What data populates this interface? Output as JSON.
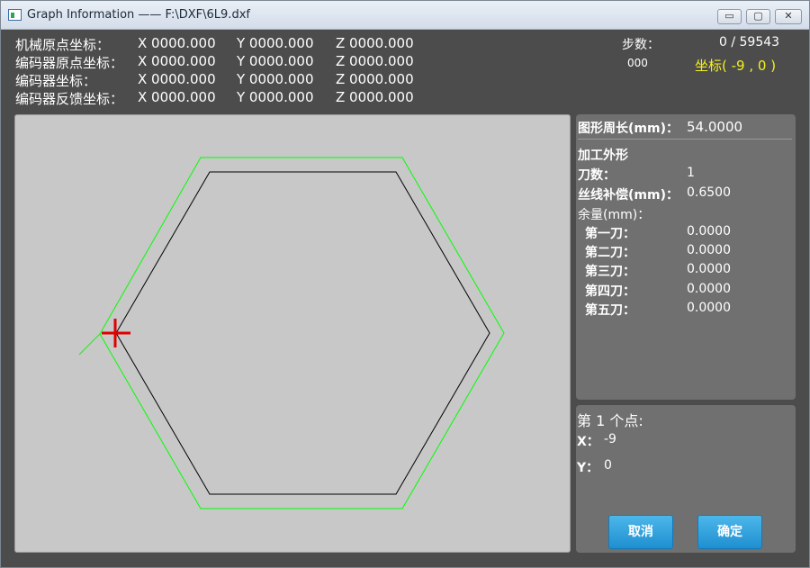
{
  "window": {
    "title": "Graph Information —— F:\\DXF\\6L9.dxf",
    "controls": {
      "minimize": "▭",
      "maximize": "▢",
      "close": "✕"
    }
  },
  "coords": [
    {
      "label": "机械原点坐标：",
      "x": "X  0000.000",
      "y": "Y  0000.000",
      "z": "Z  0000.000"
    },
    {
      "label": "编码器原点坐标：",
      "x": "X  0000.000",
      "y": "Y  0000.000",
      "z": "Z  0000.000"
    },
    {
      "label": "编码器坐标：",
      "x": "X  0000.000",
      "y": "Y  0000.000",
      "z": "Z  0000.000"
    },
    {
      "label": "编码器反馈坐标：",
      "x": "X  0000.000",
      "y": "Y  0000.000",
      "z": "Z  0000.000"
    }
  ],
  "status": {
    "steps_label": "步数：",
    "steps_value": "0 / 59543",
    "code": "000",
    "coordinate": "坐标( -9 , 0 )"
  },
  "info": {
    "perimeter_label": "图形周长(mm)：",
    "perimeter_value": "54.0000",
    "section": "加工外形",
    "cuts_label": "刀数：",
    "cuts_value": "1",
    "wire_comp_label": "丝线补偿(mm)：",
    "wire_comp_value": "0.6500",
    "allowance_label": "余量(mm)：",
    "allowances": [
      {
        "label": "第一刀：",
        "value": "0.0000"
      },
      {
        "label": "第二刀：",
        "value": "0.0000"
      },
      {
        "label": "第三刀：",
        "value": "0.0000"
      },
      {
        "label": "第四刀：",
        "value": "0.0000"
      },
      {
        "label": "第五刀：",
        "value": "0.0000"
      }
    ]
  },
  "point": {
    "title": "第 1 个点:",
    "x_label": "X：",
    "x_value": "-9",
    "y_label": "Y：",
    "y_value": "0",
    "cancel": "取消",
    "ok": "确定"
  },
  "colors": {
    "shape_outline": "#000000",
    "offset_path": "#00ff00",
    "start_marker": "#e00000",
    "coordinate_text": "#f5f01c",
    "button": "#2a9fdc"
  }
}
